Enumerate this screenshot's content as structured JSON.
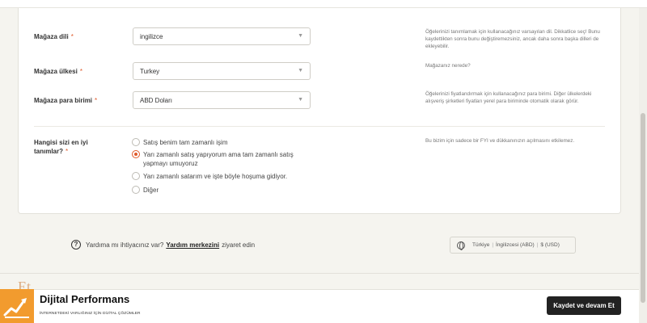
{
  "form": {
    "language": {
      "label": "Mağaza dili",
      "required_mark": "*",
      "value": "ingilizce",
      "help": "Öğelerinizi tanımlamak için kullanacağınız varsayılan dil. Dikkatlice seç! Bunu kaydettikten sonra bunu değiştiremezsiniz, ancak daha sonra başka dilleri de ekleyebilir."
    },
    "country": {
      "label": "Mağaza ülkesi",
      "required_mark": "*",
      "value": "Turkey",
      "help": "Mağazanız nerede?"
    },
    "currency": {
      "label": "Mağaza para birimi",
      "required_mark": "*",
      "value": "ABD Doları",
      "help": "Öğelerinizi fiyatlandırmak için kullanacağınız para birimi. Diğer ülkelerdeki alışveriş şirketleri fiyatları yerel para biriminde otomatik olarak görür."
    },
    "describe": {
      "label": "Hangisi sizi en iyi tanımlar?",
      "required_mark": "*",
      "help": "Bu bizim için sadece bir FYI ve dükkanınızın açılmasını etkilemez.",
      "options": [
        {
          "label": "Satış benim tam zamanlı işim",
          "checked": false
        },
        {
          "label": "Yarı zamanlı satış yapıyorum ama tam zamanlı satış yapmayı umuyoruz",
          "checked": true
        },
        {
          "label": "Yarı zamanlı satarım ve işte böyle hoşuma gidiyor.",
          "checked": false
        },
        {
          "label": "Diğer",
          "checked": false
        }
      ]
    }
  },
  "help_bar": {
    "prefix": "Yardıma mı ihtiyacınız var?",
    "link": "Yardım merkezini",
    "suffix": "ziyaret edin"
  },
  "locale": {
    "country": "Türkiye",
    "language": "İngilizcesi (ABD)",
    "currency": "$ (USD)"
  },
  "footer": {
    "etsy_ghost": "Et",
    "brand_name": "Dijital Performans",
    "brand_tagline": "İNTERNETDEKİ VARLIĞINIZ İÇİN DİJİTAL ÇÖZÜMLER",
    "save_button": "Kaydet ve devam Et"
  },
  "colors": {
    "accent": "#e05a2b",
    "brand": "#f29b2e",
    "button": "#222222"
  },
  "icons": {
    "help": "question-circle-icon",
    "locale": "globe-icon",
    "select": "chevron-down-icon"
  }
}
